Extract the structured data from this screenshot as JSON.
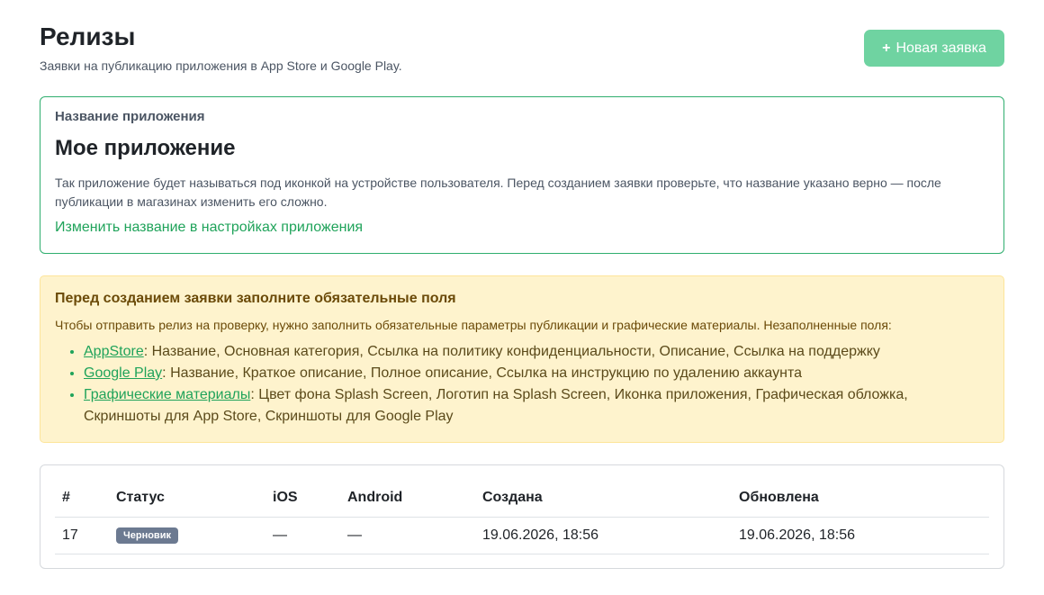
{
  "header": {
    "title": "Релизы",
    "subtitle": "Заявки на публикацию приложения в App Store и Google Play.",
    "new_button": "Новая заявка"
  },
  "app_card": {
    "label": "Название приложения",
    "name": "Мое приложение",
    "description": "Так приложение будет называться под иконкой на устройстве пользователя. Перед созданием заявки проверьте, что название указано верно — после публикации в магазинах изменить его сложно.",
    "link": "Изменить название в настройках приложения"
  },
  "warning": {
    "title": "Перед созданием заявки заполните обязательные поля",
    "description": "Чтобы отправить релиз на проверку, нужно заполнить обязательные параметры публикации и графические материалы. Незаполненные поля:",
    "items": [
      {
        "link": "AppStore",
        "text": ": Название, Основная категория, Ссылка на политику конфиденциальности, Описание, Ссылка на поддержку"
      },
      {
        "link": "Google Play",
        "text": ": Название, Краткое описание, Полное описание, Ссылка на инструкцию по удалению аккаунта"
      },
      {
        "link": "Графические материалы",
        "text": ": Цвет фона Splash Screen, Логотип на Splash Screen, Иконка приложения, Графическая обложка, Скриншоты для App Store, Скриншоты для Google Play"
      }
    ]
  },
  "table": {
    "columns": [
      "#",
      "Статус",
      "iOS",
      "Android",
      "Создана",
      "Обновлена"
    ],
    "rows": [
      {
        "id": "17",
        "status": "Черновик",
        "ios": "—",
        "android": "—",
        "created": "19.06.2026, 18:56",
        "updated": "19.06.2026, 18:56"
      }
    ]
  },
  "colors": {
    "accent": "#1fa35a",
    "button": "#6fd3a1",
    "warning_bg": "#fef3cd",
    "badge": "#6c7a91"
  }
}
